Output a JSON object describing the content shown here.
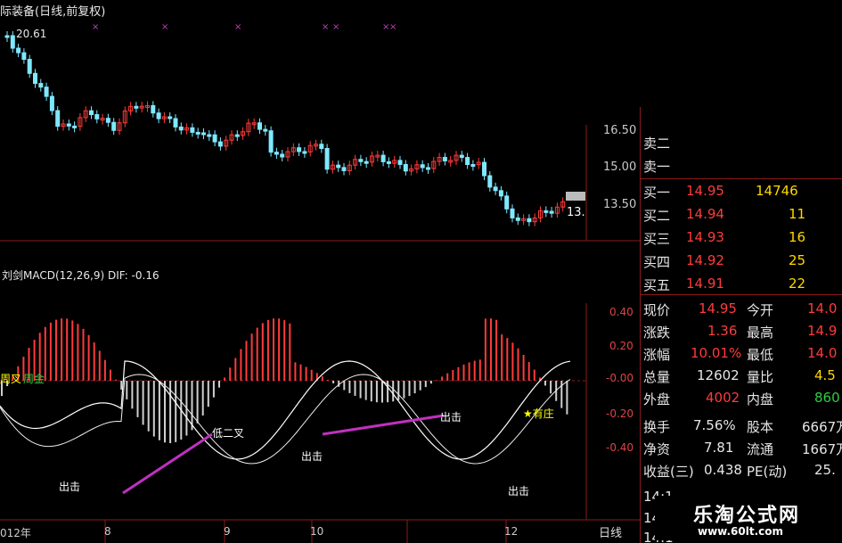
{
  "header": {
    "title": "际装备(日线,前复权)",
    "peak_price": "20.61",
    "macd_label": "刘剑MACD(12,26,9)  DIF: -0.16"
  },
  "price_axis": [
    "16.50",
    "15.00",
    "13.50"
  ],
  "price_tag": "13.",
  "macd_axis": [
    "0.40",
    "0.20",
    "-0.00",
    "-0.20",
    "-0.40"
  ],
  "date_axis": [
    "012年",
    "8",
    "9",
    "10",
    "12"
  ],
  "date_tab": "日线",
  "annotations": {
    "left_tag": "周叉",
    "left_tag2": "周金",
    "chuji": "出击",
    "di_er_cha": "低二叉",
    "you_zhuang": "★有庄"
  },
  "order_book": {
    "sell": [
      {
        "label": "卖二"
      },
      {
        "label": "卖一"
      }
    ],
    "buy": [
      {
        "label": "买一",
        "price": "14.95",
        "vol": "14746"
      },
      {
        "label": "买二",
        "price": "14.94",
        "vol": "11"
      },
      {
        "label": "买三",
        "price": "14.93",
        "vol": "16"
      },
      {
        "label": "买四",
        "price": "14.92",
        "vol": "25"
      },
      {
        "label": "买五",
        "price": "14.91",
        "vol": "22"
      }
    ]
  },
  "quote": [
    {
      "l1": "现价",
      "v1": "14.95",
      "l2": "今开",
      "v2": "14.0"
    },
    {
      "l1": "涨跌",
      "v1": "1.36",
      "l2": "最高",
      "v2": "14.9"
    },
    {
      "l1": "涨幅",
      "v1": "10.01%",
      "l2": "最低",
      "v2": "14.0"
    },
    {
      "l1": "总量",
      "v1": "12602",
      "l2": "量比",
      "v2": "4.5"
    },
    {
      "l1": "外盘",
      "v1": "4002",
      "l2": "内盘",
      "v2": "860"
    },
    {
      "l1": "换手",
      "v1": "7.56%",
      "l2": "股本",
      "v2": "6667万"
    },
    {
      "l1": "净资",
      "v1": "7.81",
      "l2": "流通",
      "v2": "1667万"
    },
    {
      "l1": "收益(三)",
      "v1": "0.438",
      "l2": "PE(动)",
      "v2": "25."
    }
  ],
  "ticks": [
    "14:1",
    "14:1",
    "14:1"
  ],
  "watermark": {
    "name": "乐淘公式网",
    "url": "www.60lt.com"
  },
  "colors": {
    "up": "#ff3b3b",
    "down": "#7fe8ff",
    "macd_neg": "#cfcfcf",
    "trend": "#c030c0",
    "grid": "#8b1a1a"
  }
}
